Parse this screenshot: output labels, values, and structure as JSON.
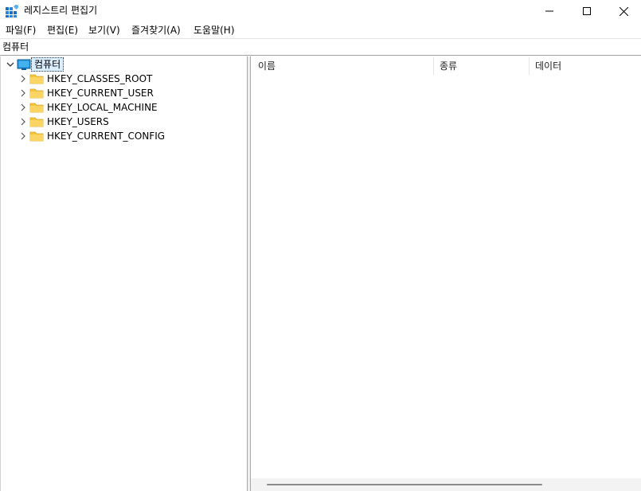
{
  "window": {
    "title": "레지스트리 편집기",
    "icon": "registry-editor-icon",
    "controls": [
      "minimize-icon",
      "maximize-icon",
      "close-icon"
    ]
  },
  "menu": [
    {
      "label": "파일(F)"
    },
    {
      "label": "편집(E)"
    },
    {
      "label": "보기(V)"
    },
    {
      "label": "즐겨찾기(A)"
    },
    {
      "label": "도움말(H)"
    }
  ],
  "address": {
    "path": "컴퓨터"
  },
  "tree": {
    "root": {
      "label": "컴퓨터",
      "icon": "computer-icon",
      "expanded": true,
      "selected": true
    },
    "children": [
      {
        "label": "HKEY_CLASSES_ROOT",
        "icon": "folder-icon"
      },
      {
        "label": "HKEY_CURRENT_USER",
        "icon": "folder-icon"
      },
      {
        "label": "HKEY_LOCAL_MACHINE",
        "icon": "folder-icon"
      },
      {
        "label": "HKEY_USERS",
        "icon": "folder-icon"
      },
      {
        "label": "HKEY_CURRENT_CONFIG",
        "icon": "folder-icon"
      }
    ]
  },
  "list": {
    "columns": [
      {
        "label": "이름"
      },
      {
        "label": "종류"
      },
      {
        "label": "데이터"
      }
    ],
    "rows": []
  },
  "colors": {
    "folder": "#f5c542",
    "selection_bg": "#dbeeff",
    "computer_icon": "#1e8fd6"
  }
}
